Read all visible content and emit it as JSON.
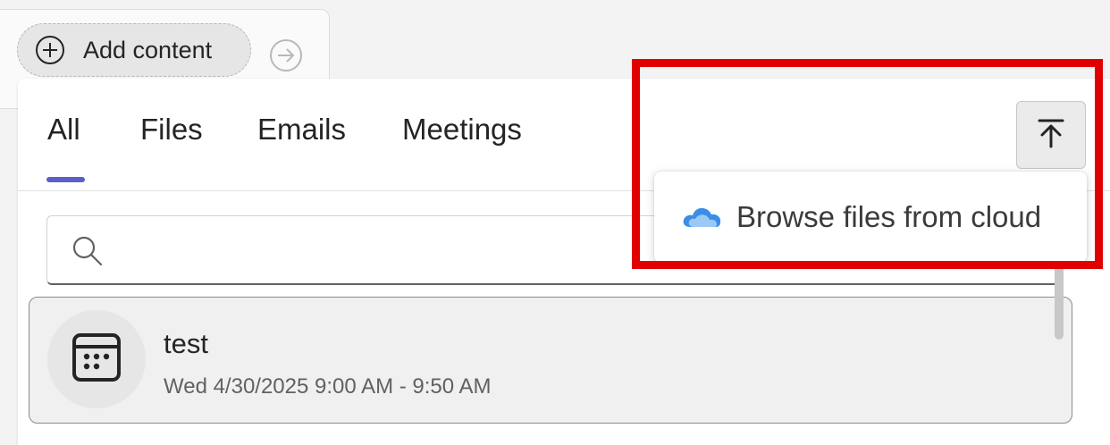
{
  "toolbar": {
    "add_content_label": "Add content",
    "add_icon": "plus-circle-icon",
    "next_icon": "arrow-right-circle-icon"
  },
  "tabs": [
    {
      "label": "All",
      "selected": true
    },
    {
      "label": "Files",
      "selected": false
    },
    {
      "label": "Emails",
      "selected": false
    },
    {
      "label": "Meetings",
      "selected": false
    }
  ],
  "search": {
    "placeholder": "",
    "icon": "search-icon"
  },
  "results": [
    {
      "title": "test",
      "subtitle": "Wed 4/30/2025 9:00 AM - 9:50 AM",
      "icon": "calendar-icon"
    }
  ],
  "upload": {
    "icon": "upload-icon"
  },
  "menu": {
    "items": [
      {
        "label": "Browse files from cloud",
        "icon": "onedrive-cloud-icon"
      }
    ]
  },
  "colors": {
    "accent": "#5b5fc7",
    "highlight": "#e00000",
    "cloud": "#0f6cbd"
  }
}
